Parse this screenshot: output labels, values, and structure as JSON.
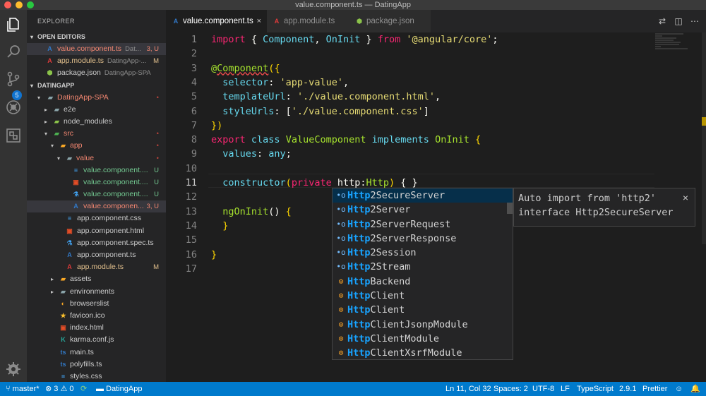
{
  "window": {
    "title": "value.component.ts — DatingApp"
  },
  "activity_bar": {
    "scm_badge": "5"
  },
  "sidebar": {
    "title": "EXPLORER",
    "open_editors": {
      "header": "OPEN EDITORS",
      "items": [
        {
          "name": "value.component.ts",
          "desc": "Dat...",
          "badge": "3, U"
        },
        {
          "name": "app.module.ts",
          "desc": "DatingApp-...",
          "badge": "M"
        },
        {
          "name": "package.json",
          "desc": "DatingApp-SPA",
          "badge": ""
        }
      ]
    },
    "project": {
      "header": "DATINGAPP",
      "items": [
        {
          "name": "DatingApp-SPA",
          "badge": "•"
        },
        {
          "name": "e2e",
          "badge": ""
        },
        {
          "name": "node_modules",
          "badge": ""
        },
        {
          "name": "src",
          "badge": "•"
        },
        {
          "name": "app",
          "badge": "•"
        },
        {
          "name": "value",
          "badge": "•"
        },
        {
          "name": "value.component....",
          "badge": "U"
        },
        {
          "name": "value.component....",
          "badge": "U"
        },
        {
          "name": "value.component....",
          "badge": "U"
        },
        {
          "name": "value.componen...",
          "badge": "3, U"
        },
        {
          "name": "app.component.css",
          "badge": ""
        },
        {
          "name": "app.component.html",
          "badge": ""
        },
        {
          "name": "app.component.spec.ts",
          "badge": ""
        },
        {
          "name": "app.component.ts",
          "badge": ""
        },
        {
          "name": "app.module.ts",
          "badge": "M"
        },
        {
          "name": "assets",
          "badge": ""
        },
        {
          "name": "environments",
          "badge": ""
        },
        {
          "name": "browserslist",
          "badge": ""
        },
        {
          "name": "favicon.ico",
          "badge": ""
        },
        {
          "name": "index.html",
          "badge": ""
        },
        {
          "name": "karma.conf.js",
          "badge": ""
        },
        {
          "name": "main.ts",
          "badge": ""
        },
        {
          "name": "polyfills.ts",
          "badge": ""
        },
        {
          "name": "styles.css",
          "badge": ""
        }
      ]
    }
  },
  "tabs": [
    {
      "label": "value.component.ts",
      "close": "×"
    },
    {
      "label": "app.module.ts"
    },
    {
      "label": "package.json"
    }
  ],
  "editor": {
    "line_numbers": [
      "1",
      "2",
      "3",
      "4",
      "5",
      "6",
      "7",
      "8",
      "9",
      "10",
      "11",
      "12",
      "13",
      "14",
      "15",
      "16",
      "17"
    ],
    "tokens": {
      "l1": [
        "import",
        " { ",
        "Component",
        ", ",
        "OnInit",
        " } ",
        "from",
        " ",
        "'@angular/core'",
        ";"
      ],
      "l3": [
        "@",
        "Component",
        "(",
        "{"
      ],
      "l4": [
        "  selector",
        ": ",
        "'app-value'",
        ","
      ],
      "l5": [
        "  templateUrl",
        ": ",
        "'./value.component.html'",
        ","
      ],
      "l6": [
        "  styleUrls",
        ": [",
        "'./value.component.css'",
        "]"
      ],
      "l7": [
        "}",
        ")"
      ],
      "l8": [
        "export",
        " ",
        "class",
        " ",
        "ValueComponent",
        " ",
        "implements",
        " ",
        "OnInit",
        " ",
        "{"
      ],
      "l9": [
        "  values",
        ": ",
        "any",
        ";"
      ],
      "l11": [
        "  ",
        "constructor",
        "(",
        "private",
        " http:",
        "Http",
        ")",
        " { }"
      ],
      "l13": [
        "  ngOnInit",
        "() ",
        "{"
      ],
      "l14": [
        "  }"
      ],
      "l16": [
        "}"
      ]
    }
  },
  "suggest": {
    "items": [
      {
        "match": "Http",
        "rest": "2SecureServer",
        "kind": "property"
      },
      {
        "match": "Http",
        "rest": "2Server",
        "kind": "property"
      },
      {
        "match": "Http",
        "rest": "2ServerRequest",
        "kind": "property"
      },
      {
        "match": "Http",
        "rest": "2ServerResponse",
        "kind": "property"
      },
      {
        "match": "Http",
        "rest": "2Session",
        "kind": "property"
      },
      {
        "match": "Http",
        "rest": "2Stream",
        "kind": "property"
      },
      {
        "match": "Http",
        "rest": "Backend",
        "kind": "class"
      },
      {
        "match": "Http",
        "rest": "Client",
        "kind": "class"
      },
      {
        "match": "Http",
        "rest": "Client",
        "kind": "class"
      },
      {
        "match": "Http",
        "rest": "ClientJsonpModule",
        "kind": "class"
      },
      {
        "match": "Http",
        "rest": "ClientModule",
        "kind": "class"
      },
      {
        "match": "Http",
        "rest": "ClientXsrfModule",
        "kind": "class"
      }
    ],
    "details": {
      "line1": "Auto import from 'http2'",
      "line2": "interface Http2SecureServer",
      "close": "×"
    }
  },
  "statusbar": {
    "branch": "master*",
    "errors": "3",
    "warnings": "0",
    "folder": "DatingApp",
    "cursor": "Ln 11, Col 32",
    "spaces": "Spaces: 2",
    "encoding": "UTF-8",
    "eol": "LF",
    "language": "TypeScript",
    "ts_version": "2.9.1",
    "formatter": "Prettier"
  }
}
